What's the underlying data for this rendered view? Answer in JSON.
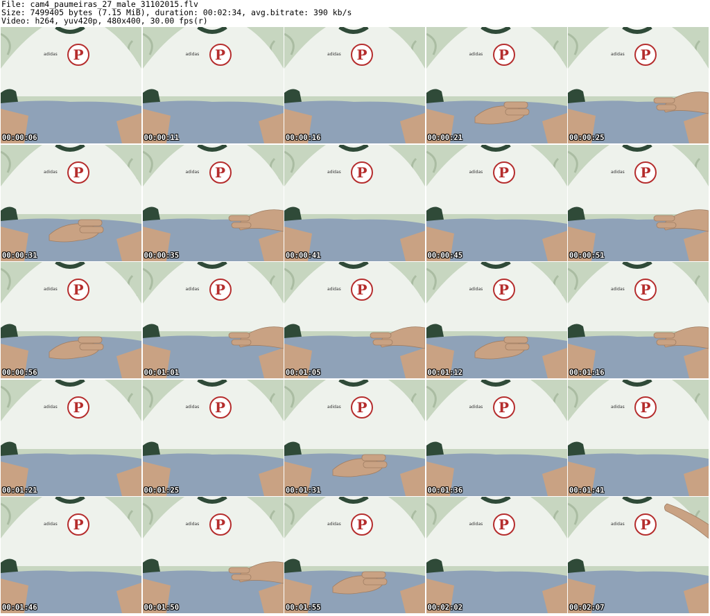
{
  "header": {
    "file_line": "File: cam4_paumeiras_27_male_31102015.flv",
    "size_line": "Size: 7499405 bytes (7.15 MiB), duration: 00:02:34, avg.bitrate: 390 kb/s",
    "video_line": "Video: h264, yuv420p, 480x400, 30.00 fps(r)"
  },
  "thumbnail_content": {
    "logo_letter": "P",
    "brand_text": "adidas"
  },
  "colors": {
    "wallpaper": "#c7d6c0",
    "shirt": "#eef2ec",
    "collar": "#2f4a38",
    "shorts": "#8fa2b8",
    "skin": "#c9a283",
    "crest_red": "#b52d2d"
  },
  "frames": [
    {
      "timestamp": "00:00:06",
      "hand": "none"
    },
    {
      "timestamp": "00:00:11",
      "hand": "none"
    },
    {
      "timestamp": "00:00:16",
      "hand": "none"
    },
    {
      "timestamp": "00:00:21",
      "hand": "center"
    },
    {
      "timestamp": "00:00:25",
      "hand": "right"
    },
    {
      "timestamp": "00:00:31",
      "hand": "center"
    },
    {
      "timestamp": "00:00:35",
      "hand": "right"
    },
    {
      "timestamp": "00:00:41",
      "hand": "none"
    },
    {
      "timestamp": "00:00:45",
      "hand": "none"
    },
    {
      "timestamp": "00:00:51",
      "hand": "right"
    },
    {
      "timestamp": "00:00:56",
      "hand": "center"
    },
    {
      "timestamp": "00:01:01",
      "hand": "right"
    },
    {
      "timestamp": "00:01:05",
      "hand": "right"
    },
    {
      "timestamp": "00:01:12",
      "hand": "center"
    },
    {
      "timestamp": "00:01:16",
      "hand": "right"
    },
    {
      "timestamp": "00:01:21",
      "hand": "none"
    },
    {
      "timestamp": "00:01:25",
      "hand": "none"
    },
    {
      "timestamp": "00:01:31",
      "hand": "center"
    },
    {
      "timestamp": "00:01:36",
      "hand": "none"
    },
    {
      "timestamp": "00:01:41",
      "hand": "none"
    },
    {
      "timestamp": "00:01:46",
      "hand": "none"
    },
    {
      "timestamp": "00:01:50",
      "hand": "right"
    },
    {
      "timestamp": "00:01:55",
      "hand": "center"
    },
    {
      "timestamp": "00:02:02",
      "hand": "none"
    },
    {
      "timestamp": "00:02:07",
      "hand": "raised"
    }
  ]
}
